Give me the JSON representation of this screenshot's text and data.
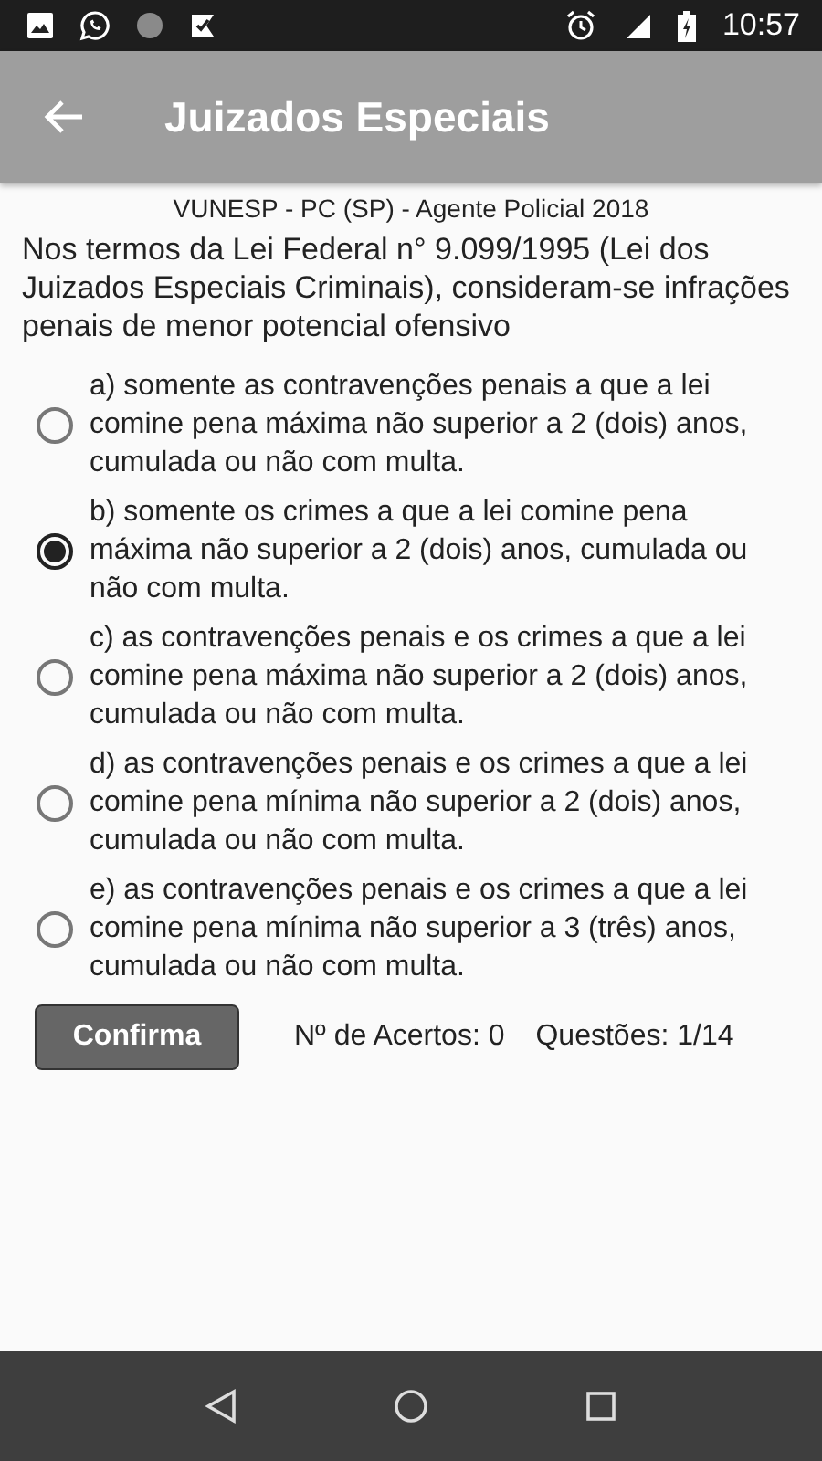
{
  "status_bar": {
    "time": "10:57"
  },
  "app_bar": {
    "title": "Juizados Especiais"
  },
  "question": {
    "source": "VUNESP - PC (SP) - Agente Policial 2018",
    "text": "Nos termos da Lei Federal n° 9.099/1995 (Lei dos Juizados Especiais Criminais), consideram-se infrações penais de menor potencial ofensivo"
  },
  "options": [
    {
      "label": "a) somente as contravenções penais a que a lei comine pena máxima não superior a 2 (dois) anos, cumulada ou não com multa.",
      "selected": false
    },
    {
      "label": "b) somente os crimes a que a lei comine pena máxima não superior a 2 (dois) anos, cumulada ou não com multa.",
      "selected": true
    },
    {
      "label": "c) as contravenções penais e os crimes a que a lei comine pena máxima não superior a 2 (dois) anos, cumulada ou não com multa.",
      "selected": false
    },
    {
      "label": "d) as contravenções penais e os crimes a que a lei comine pena mínima não superior a 2 (dois) anos, cumulada ou não com multa.",
      "selected": false
    },
    {
      "label": "e) as contravenções penais e os crimes a que a lei comine pena mínima não superior a 3 (três) anos, cumulada ou não com multa.",
      "selected": false
    }
  ],
  "footer": {
    "button": "Confirma",
    "score": "Nº de Acertos: 0",
    "progress": "Questões: 1/14"
  }
}
